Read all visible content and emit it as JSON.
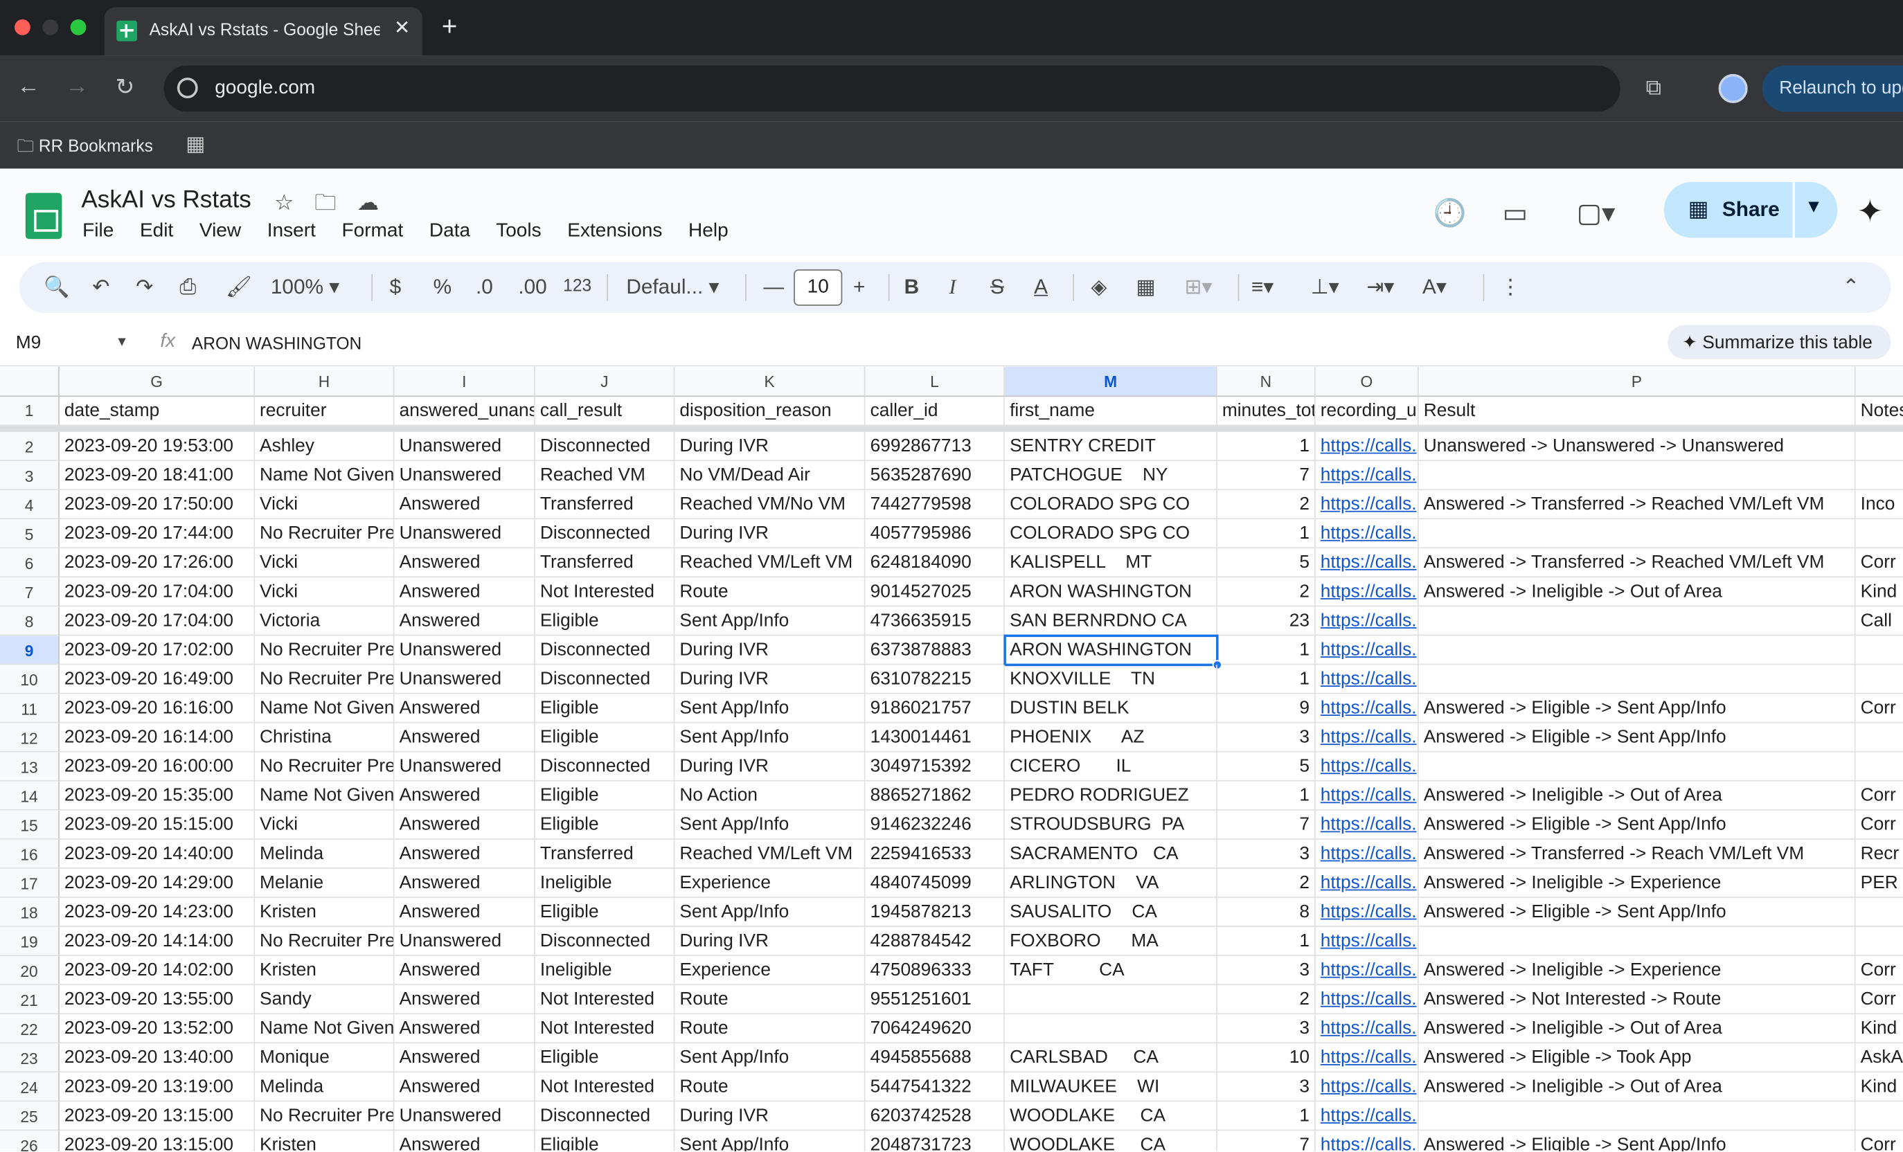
{
  "browser": {
    "tab_title": "AskAI vs Rstats - Google Sheets",
    "url": "google.com",
    "relaunch_label": "Relaunch to update",
    "bookmark_folder": "RR Bookmarks"
  },
  "sheets": {
    "doc_title": "AskAI vs Rstats",
    "menus": [
      "File",
      "Edit",
      "View",
      "Insert",
      "Format",
      "Data",
      "Tools",
      "Extensions",
      "Help"
    ],
    "share_label": "Share"
  },
  "toolbar": {
    "zoom": "100%",
    "currency": "$",
    "percent": "%",
    "dec_decrease": ".0",
    "dec_increase": ".00",
    "number_format": "123",
    "font": "Defaul...",
    "font_size": "10"
  },
  "formula_bar": {
    "cell_ref": "M9",
    "formula": "ARON WASHINGTON",
    "summarize_label": "Summarize this table"
  },
  "grid": {
    "columns": [
      {
        "letter": "G",
        "header": "date_stamp"
      },
      {
        "letter": "H",
        "header": "recruiter"
      },
      {
        "letter": "I",
        "header": "answered_unanswered"
      },
      {
        "letter": "J",
        "header": "call_result"
      },
      {
        "letter": "K",
        "header": "disposition_reason"
      },
      {
        "letter": "L",
        "header": "caller_id"
      },
      {
        "letter": "M",
        "header": "first_name"
      },
      {
        "letter": "N",
        "header": "minutes_total"
      },
      {
        "letter": "O",
        "header": "recording_url"
      },
      {
        "letter": "P",
        "header": "Result"
      },
      {
        "letter": "",
        "header": "Notes"
      }
    ],
    "rows": [
      {
        "n": "2",
        "c": [
          "2023-09-20 19:53:00",
          "Ashley",
          "Unanswered",
          "Disconnected",
          "During IVR",
          "6992867713",
          "SENTRY CREDIT",
          "1",
          "https://calls.",
          "Unanswered -> Unanswered -> Unanswered",
          ""
        ]
      },
      {
        "n": "3",
        "c": [
          "2023-09-20 18:41:00",
          "Name Not Given",
          "Unanswered",
          "Reached VM",
          "No VM/Dead Air",
          "5635287690",
          "PATCHOGUE    NY",
          "7",
          "https://calls.",
          "",
          ""
        ]
      },
      {
        "n": "4",
        "c": [
          "2023-09-20 17:50:00",
          "Vicki",
          "Answered",
          "Transferred",
          "Reached VM/No VM",
          "7442779598",
          "COLORADO SPG CO",
          "2",
          "https://calls.",
          "Answered -> Transferred -> Reached VM/Left VM",
          "Inco"
        ]
      },
      {
        "n": "5",
        "c": [
          "2023-09-20 17:44:00",
          "No Recruiter Present",
          "Unanswered",
          "Disconnected",
          "During IVR",
          "4057795986",
          "COLORADO SPG CO",
          "1",
          "https://calls.",
          "",
          ""
        ]
      },
      {
        "n": "6",
        "c": [
          "2023-09-20 17:26:00",
          "Vicki",
          "Answered",
          "Transferred",
          "Reached VM/Left VM",
          "6248184090",
          "KALISPELL    MT",
          "5",
          "https://calls.",
          "Answered -> Transferred -> Reached VM/Left VM",
          "Corr"
        ]
      },
      {
        "n": "7",
        "c": [
          "2023-09-20 17:04:00",
          "Vicki",
          "Answered",
          "Not Interested",
          "Route",
          "9014527025",
          "ARON WASHINGTON",
          "2",
          "https://calls.",
          "Answered -> Ineligible -> Out of Area",
          "Kind"
        ]
      },
      {
        "n": "8",
        "c": [
          "2023-09-20 17:04:00",
          "Victoria",
          "Answered",
          "Eligible",
          "Sent App/Info",
          "4736635915",
          "SAN BERNRDNO CA",
          "23",
          "https://calls.",
          "",
          "Call"
        ]
      },
      {
        "n": "9",
        "c": [
          "2023-09-20 17:02:00",
          "No Recruiter Present",
          "Unanswered",
          "Disconnected",
          "During IVR",
          "6373878883",
          "ARON WASHINGTON",
          "1",
          "https://calls.",
          "",
          ""
        ]
      },
      {
        "n": "10",
        "c": [
          "2023-09-20 16:49:00",
          "No Recruiter Present",
          "Unanswered",
          "Disconnected",
          "During IVR",
          "6310782215",
          "KNOXVILLE    TN",
          "1",
          "https://calls.",
          "",
          ""
        ]
      },
      {
        "n": "11",
        "c": [
          "2023-09-20 16:16:00",
          "Name Not Given",
          "Answered",
          "Eligible",
          "Sent App/Info",
          "9186021757",
          "DUSTIN BELK",
          "9",
          "https://calls.",
          "Answered -> Eligible -> Sent App/Info",
          "Corr"
        ]
      },
      {
        "n": "12",
        "c": [
          "2023-09-20 16:14:00",
          "Christina",
          "Answered",
          "Eligible",
          "Sent App/Info",
          "1430014461",
          "PHOENIX      AZ",
          "3",
          "https://calls.",
          "Answered -> Eligible -> Sent App/Info",
          ""
        ]
      },
      {
        "n": "13",
        "c": [
          "2023-09-20 16:00:00",
          "No Recruiter Present",
          "Unanswered",
          "Disconnected",
          "During IVR",
          "3049715392",
          "CICERO       IL",
          "5",
          "https://calls.",
          "",
          ""
        ]
      },
      {
        "n": "14",
        "c": [
          "2023-09-20 15:35:00",
          "Name Not Given",
          "Answered",
          "Eligible",
          "No Action",
          "8865271862",
          "PEDRO RODRIGUEZ",
          "1",
          "https://calls.",
          "Answered -> Ineligible -> Out of Area",
          "Corr"
        ]
      },
      {
        "n": "15",
        "c": [
          "2023-09-20 15:15:00",
          "Vicki",
          "Answered",
          "Eligible",
          "Sent App/Info",
          "9146232246",
          "STROUDSBURG  PA",
          "7",
          "https://calls.",
          "Answered -> Eligible -> Sent App/Info",
          "Corr"
        ]
      },
      {
        "n": "16",
        "c": [
          "2023-09-20 14:40:00",
          "Melinda",
          "Answered",
          "Transferred",
          "Reached VM/Left VM",
          "2259416533",
          "SACRAMENTO   CA",
          "3",
          "https://calls.",
          "Answered -> Transferred -> Reach VM/Left VM",
          "Recr"
        ]
      },
      {
        "n": "17",
        "c": [
          "2023-09-20 14:29:00",
          "Melanie",
          "Answered",
          "Ineligible",
          "Experience",
          "4840745099",
          "ARLINGTON    VA",
          "2",
          "https://calls.",
          "Answered -> Ineligible -> Experience",
          "PER"
        ]
      },
      {
        "n": "18",
        "c": [
          "2023-09-20 14:23:00",
          "Kristen",
          "Answered",
          "Eligible",
          "Sent App/Info",
          "1945878213",
          "SAUSALITO    CA",
          "8",
          "https://calls.",
          "Answered -> Eligible -> Sent App/Info",
          ""
        ]
      },
      {
        "n": "19",
        "c": [
          "2023-09-20 14:14:00",
          "No Recruiter Present",
          "Unanswered",
          "Disconnected",
          "During IVR",
          "4288784542",
          "FOXBORO      MA",
          "1",
          "https://calls.",
          "",
          ""
        ]
      },
      {
        "n": "20",
        "c": [
          "2023-09-20 14:02:00",
          "Kristen",
          "Answered",
          "Ineligible",
          "Experience",
          "4750896333",
          "TAFT         CA",
          "3",
          "https://calls.",
          "Answered -> Ineligible -> Experience",
          "Corr"
        ]
      },
      {
        "n": "21",
        "c": [
          "2023-09-20 13:55:00",
          "Sandy",
          "Answered",
          "Not Interested",
          "Route",
          "9551251601",
          "",
          "2",
          "https://calls.",
          "Answered -> Not Interested -> Route",
          "Corr"
        ]
      },
      {
        "n": "22",
        "c": [
          "2023-09-20 13:52:00",
          "Name Not Given",
          "Answered",
          "Not Interested",
          "Route",
          "7064249620",
          "",
          "3",
          "https://calls.",
          "Answered -> Ineligible -> Out of Area",
          "Kind"
        ]
      },
      {
        "n": "23",
        "c": [
          "2023-09-20 13:40:00",
          "Monique",
          "Answered",
          "Eligible",
          "Sent App/Info",
          "4945855688",
          "CARLSBAD     CA",
          "10",
          "https://calls.",
          "Answered -> Eligible -> Took App",
          "AskA"
        ]
      },
      {
        "n": "24",
        "c": [
          "2023-09-20 13:19:00",
          "Melinda",
          "Answered",
          "Not Interested",
          "Route",
          "5447541322",
          "MILWAUKEE    WI",
          "3",
          "https://calls.",
          "Answered -> Ineligible -> Out of Area",
          "Kind"
        ]
      },
      {
        "n": "25",
        "c": [
          "2023-09-20 13:15:00",
          "No Recruiter Present",
          "Unanswered",
          "Disconnected",
          "During IVR",
          "6203742528",
          "WOODLAKE     CA",
          "1",
          "https://calls.",
          "",
          ""
        ]
      },
      {
        "n": "26",
        "c": [
          "2023-09-20 13:15:00",
          "Kristen",
          "Answered",
          "Eligible",
          "Sent App/Info",
          "2048731723",
          "WOODLAKE     CA",
          "7",
          "https://calls.",
          "Answered -> Eligible -> Sent App/Info",
          "Corr"
        ]
      }
    ]
  }
}
